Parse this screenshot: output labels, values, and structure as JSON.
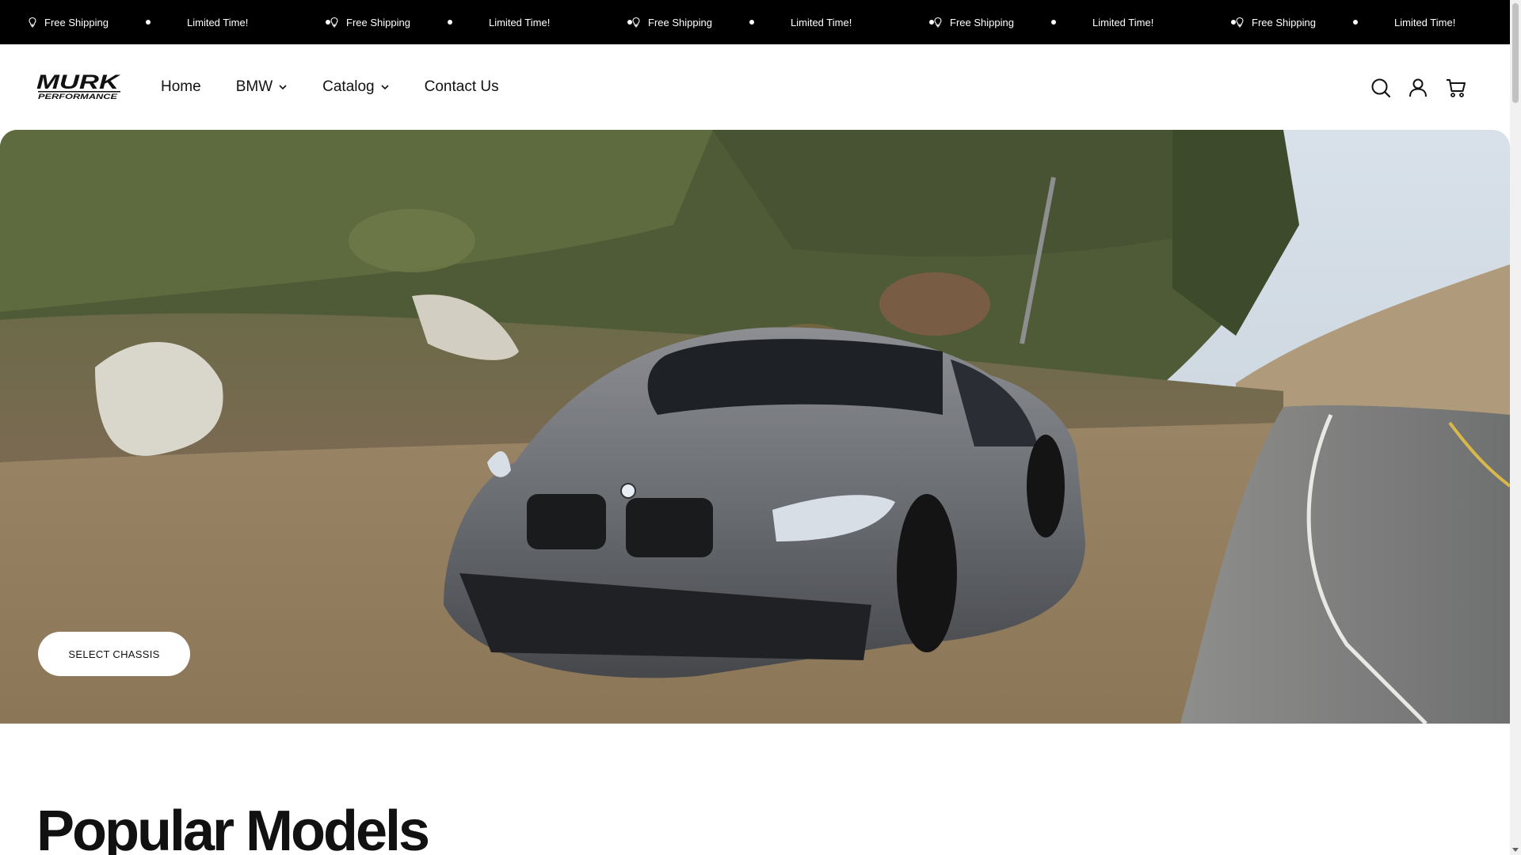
{
  "announcement": {
    "items": [
      {
        "text": "Free Shipping",
        "icon": "lightbulb-icon"
      },
      {
        "text": "Limited Time!"
      },
      {
        "text": "Free Shipping",
        "icon": "lightbulb-icon"
      },
      {
        "text": "Limited Time!"
      },
      {
        "text": "Free Shipping",
        "icon": "lightbulb-icon"
      },
      {
        "text": "Limited Time!"
      },
      {
        "text": "Free Shipping",
        "icon": "lightbulb-icon"
      },
      {
        "text": "Limited Time!"
      },
      {
        "text": "Free Shipping",
        "icon": "lightbulb-icon"
      },
      {
        "text": "Limited Time!"
      }
    ]
  },
  "header": {
    "logo": {
      "line1": "MURK",
      "line2": "PERFORMANCE"
    },
    "nav": [
      {
        "label": "Home",
        "dropdown": false
      },
      {
        "label": "BMW",
        "dropdown": true
      },
      {
        "label": "Catalog",
        "dropdown": true
      },
      {
        "label": "Contact Us",
        "dropdown": false
      }
    ],
    "icons": [
      "search-icon",
      "account-icon",
      "cart-icon"
    ]
  },
  "hero": {
    "cta_label": "SELECT CHASSIS"
  },
  "sections": {
    "popular_models_title": "Popular Models"
  },
  "colors": {
    "announcement_bg": "#000000",
    "page_bg": "#ffffff",
    "text": "#111111"
  }
}
